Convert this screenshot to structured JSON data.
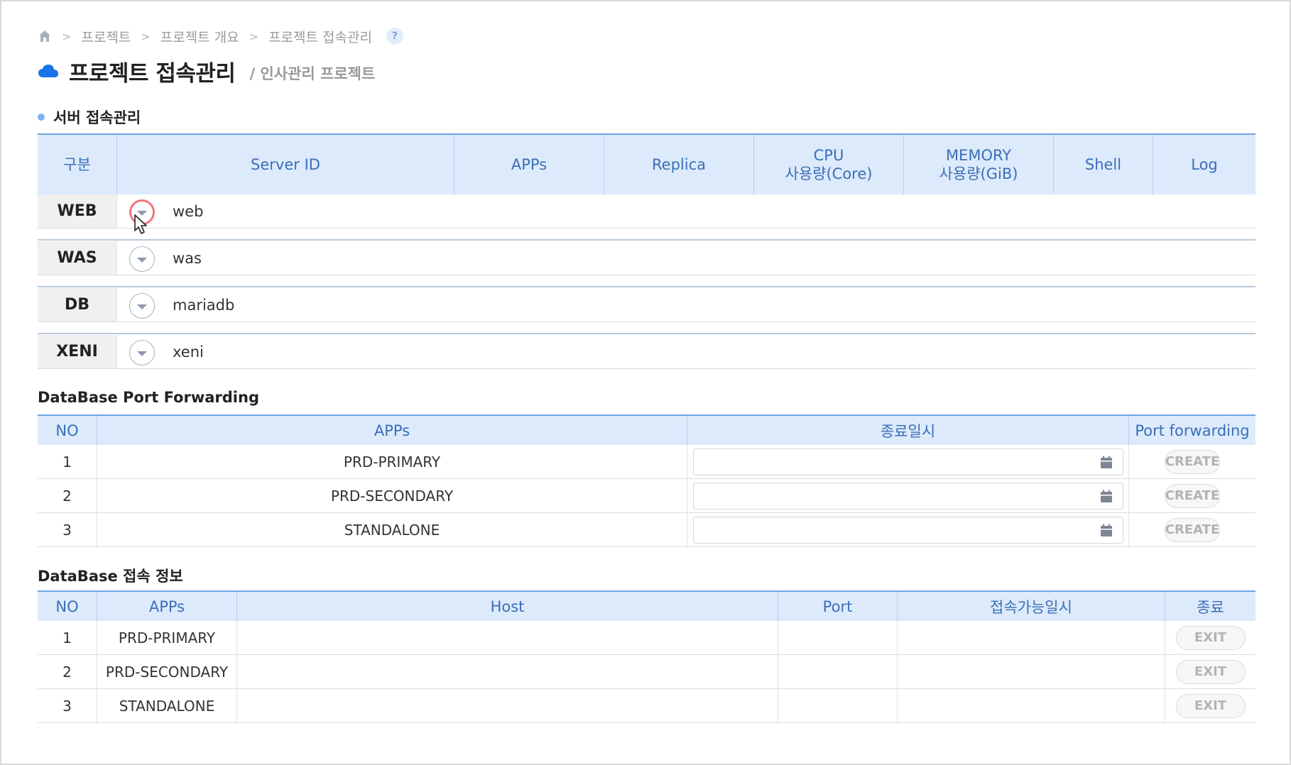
{
  "breadcrumb": {
    "items": [
      "프로젝트",
      "프로젝트 개요",
      "프로젝트 접속관리"
    ],
    "help": "?"
  },
  "header": {
    "title": "프로젝트 접속관리",
    "subtitle": "/ 인사관리 프로젝트"
  },
  "server_section": {
    "heading": "서버 접속관리",
    "columns": [
      "구분",
      "Server ID",
      "APPs",
      "Replica",
      "CPU",
      "사용량(Core)",
      "MEMORY",
      "사용량(GiB)",
      "Shell",
      "Log"
    ],
    "rows": [
      {
        "type": "WEB",
        "server_id": "web"
      },
      {
        "type": "WAS",
        "server_id": "was"
      },
      {
        "type": "DB",
        "server_id": "mariadb"
      },
      {
        "type": "XENI",
        "server_id": "xeni"
      }
    ]
  },
  "port_forwarding": {
    "heading": "DataBase Port Forwarding",
    "columns": [
      "NO",
      "APPs",
      "종료일시",
      "Port forwarding"
    ],
    "rows": [
      {
        "no": "1",
        "app": "PRD-PRIMARY",
        "end": "",
        "action": "CREATE"
      },
      {
        "no": "2",
        "app": "PRD-SECONDARY",
        "end": "",
        "action": "CREATE"
      },
      {
        "no": "3",
        "app": "STANDALONE",
        "end": "",
        "action": "CREATE"
      }
    ]
  },
  "connection_info": {
    "heading": "DataBase 접속 정보",
    "columns": [
      "NO",
      "APPs",
      "Host",
      "Port",
      "접속가능일시",
      "종료"
    ],
    "rows": [
      {
        "no": "1",
        "app": "PRD-PRIMARY",
        "host": "",
        "port": "",
        "available": "",
        "action": "EXIT"
      },
      {
        "no": "2",
        "app": "PRD-SECONDARY",
        "host": "",
        "port": "",
        "available": "",
        "action": "EXIT"
      },
      {
        "no": "3",
        "app": "STANDALONE",
        "host": "",
        "port": "",
        "available": "",
        "action": "EXIT"
      }
    ]
  },
  "colors": {
    "header_bg": "#ddeafb",
    "header_text": "#3a6fb8",
    "accent": "#1a73e8",
    "active_ring": "#f07580"
  }
}
